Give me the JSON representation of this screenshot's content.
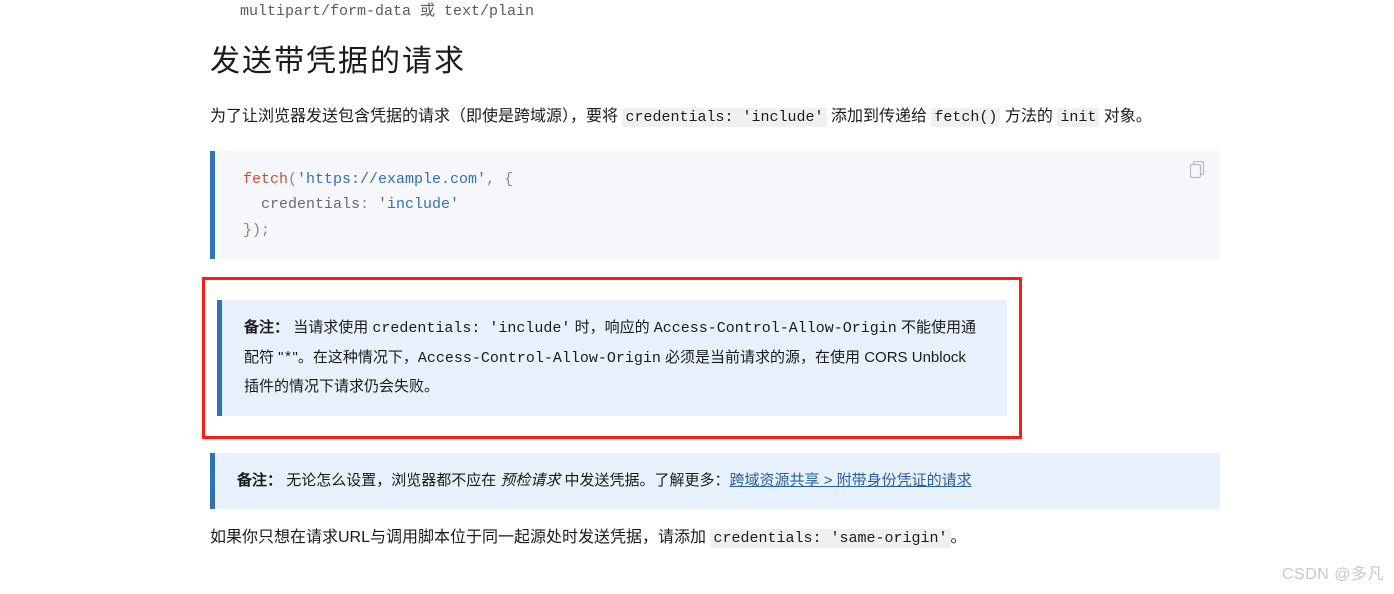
{
  "top_code_fragment": "multipart/form-data 或 text/plain",
  "heading": "发送带凭据的请求",
  "intro": {
    "prefix": "为了让浏览器发送包含凭据的请求（即使是跨域源），要将 ",
    "code1": "credentials: 'include'",
    "mid": " 添加到传递给 ",
    "code2": "fetch()",
    "mid2": " 方法的 ",
    "code3": "init",
    "suffix": " 对象。"
  },
  "code_example": {
    "fn": "fetch",
    "open_paren": "(",
    "url": "'https://example.com'",
    "comma_brace": ", {",
    "indent_key": "  credentials",
    "colon": ": ",
    "value": "'include'",
    "close": "});"
  },
  "copy_label": "copy",
  "note1": {
    "label": "备注：",
    "t1": "当请求使用 ",
    "c1": "credentials: 'include'",
    "t2": " 时，响应的 ",
    "c2": "Access-Control-Allow-Origin",
    "t3": " 不能使用通配符 \"",
    "c3": "*",
    "t4": "\"。在这种情况下，",
    "c4": "Access-Control-Allow-Origin",
    "t5": " 必须是当前请求的源，在使用 CORS Unblock 插件的情况下请求仍会失败。"
  },
  "note2": {
    "label": "备注：",
    "t1": "无论怎么设置，浏览器都不应在 ",
    "em1": "预检请求",
    "t2": " 中发送凭据。了解更多：",
    "link": "跨域资源共享 > 附带身份凭证的请求"
  },
  "outro": {
    "t1": "如果你只想在请求URL与调用脚本位于同一起源处时发送凭据，请添加 ",
    "c1": "credentials: 'same-origin'",
    "t2": "。"
  },
  "watermark": "CSDN @多凡"
}
